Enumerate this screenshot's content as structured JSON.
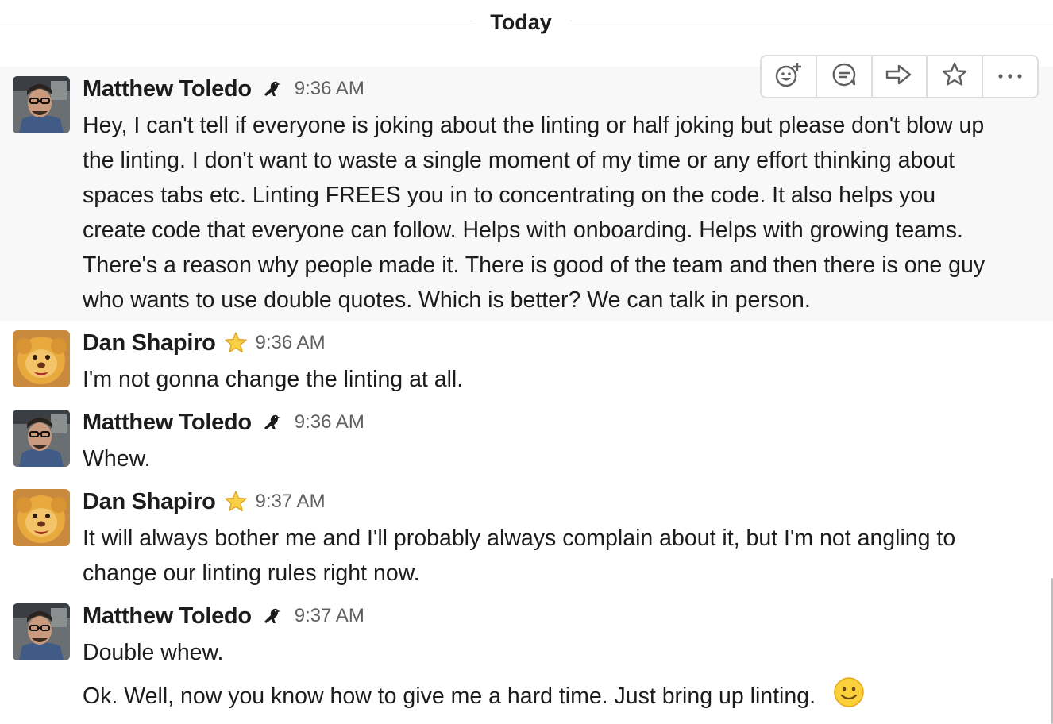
{
  "divider": {
    "label": "Today"
  },
  "actions": [
    {
      "name": "add-reaction-icon"
    },
    {
      "name": "start-thread-icon"
    },
    {
      "name": "share-message-icon"
    },
    {
      "name": "star-icon"
    },
    {
      "name": "more-actions-icon"
    }
  ],
  "messages": [
    {
      "sender": "Matthew Toledo",
      "status": "bird-icon",
      "time": "9:36 AM",
      "lines": [
        "Hey, I can't tell if everyone is joking about the linting or half joking but please don't blow up",
        "the linting.  I don't want to waste a single moment of my time or any effort thinking about",
        "spaces tabs etc.  Linting FREES you in to concentrating on the code.  It also helps you",
        "create code that everyone can follow.  Helps with onboarding.  Helps with growing teams.",
        "There's a reason why people made it.  There is good of the team and then there is one guy",
        "who wants to use double quotes.  Which is better?  We can talk in person."
      ]
    },
    {
      "sender": "Dan Shapiro",
      "status": "star-icon",
      "time": "9:36 AM",
      "lines": [
        "I'm not gonna change the linting at all."
      ]
    },
    {
      "sender": "Matthew Toledo",
      "status": "bird-icon",
      "time": "9:36 AM",
      "lines": [
        "Whew."
      ]
    },
    {
      "sender": "Dan Shapiro",
      "status": "star-icon",
      "time": "9:37 AM",
      "lines": [
        "It will always bother me and I'll probably always complain about it, but I'm not angling to",
        "change our linting rules right now."
      ]
    },
    {
      "sender": "Matthew Toledo",
      "status": "bird-icon",
      "time": "9:37 AM",
      "lines": [
        "Double whew."
      ]
    }
  ],
  "followup": {
    "text": "Ok.  Well, now you know how to give me a hard time.  Just bring up linting.",
    "emoji": "slightly-smiling-face-icon"
  },
  "colors": {
    "hover_bg": "#f8f8f8",
    "text": "#1d1c1d",
    "muted": "#616061",
    "border": "#dddddd"
  }
}
